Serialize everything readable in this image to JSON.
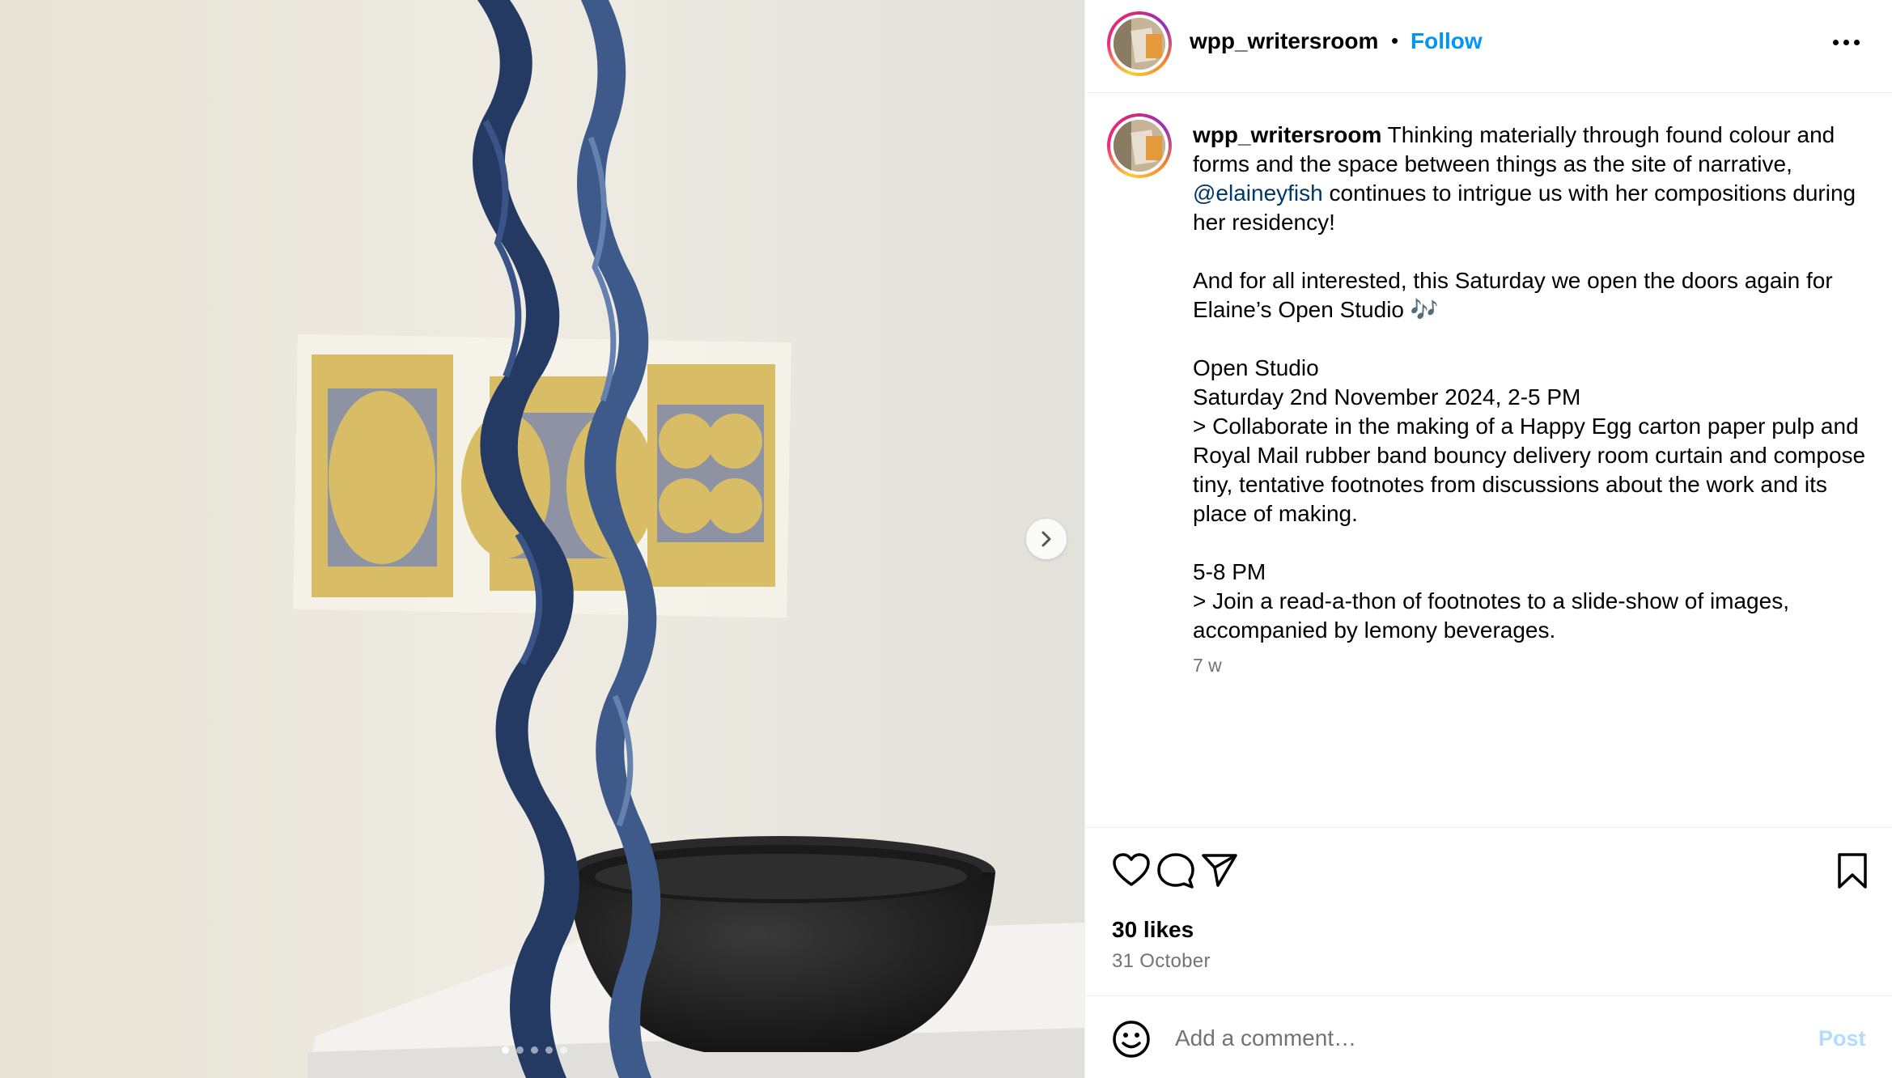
{
  "post": {
    "username": "wpp_writersroom",
    "separator": "•",
    "follow_label": "Follow",
    "more_icon": "more-horizontal-icon"
  },
  "media": {
    "description_icon": "photo",
    "next_icon": "chevron-right-icon",
    "carousel_count": 5,
    "carousel_active": 1
  },
  "caption": {
    "username": "wpp_writersroom",
    "text_1": " Thinking materially through found colour and forms and the space between things as the site of narrative, ",
    "mention": "@elaineyfish",
    "text_2": " continues to intrigue us with her compositions during her residency!",
    "para_2": "And for all interested, this Saturday we open the doors again for Elaine’s Open Studio 🎶",
    "para_3_line_1": "Open Studio",
    "para_3_line_2": "Saturday 2nd November 2024, 2-5 PM",
    "para_3_line_3": "> Collaborate in the making of a Happy Egg carton paper pulp and Royal Mail rubber band bouncy delivery room curtain and compose tiny, tentative footnotes from discussions about the work and its place of making.",
    "para_4_line_1": "5-8 PM",
    "para_4_line_2": "> Join a read-a-thon of footnotes to a slide-show of images, accompanied by lemony beverages.",
    "time": "7 w"
  },
  "actions": {
    "like_icon": "heart-icon",
    "comment_icon": "comment-icon",
    "share_icon": "paper-plane-icon",
    "save_icon": "bookmark-icon",
    "likes": "30 likes",
    "date": "31 October"
  },
  "comment": {
    "emoji_icon": "smiley-icon",
    "placeholder": "Add a comment…",
    "post_label": "Post"
  },
  "colors": {
    "follow": "#0095f6",
    "mention": "#00376b",
    "muted": "#737373",
    "post_disabled": "#b3dbff"
  }
}
